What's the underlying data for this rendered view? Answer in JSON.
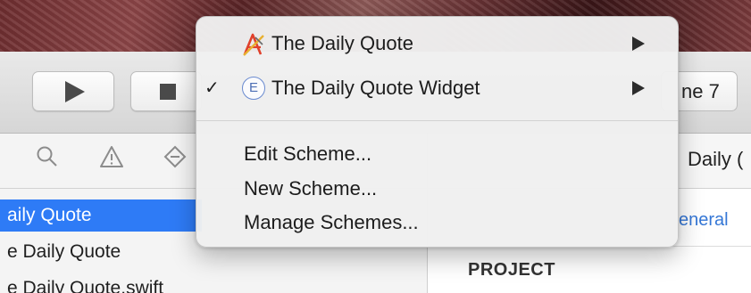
{
  "colors": {
    "accent": "#2e7bf6",
    "link": "#3577d6"
  },
  "toolbar": {
    "run_icon": "play-icon",
    "stop_icon": "stop-icon",
    "destination_partial": "ne 7"
  },
  "navigator": {
    "filter_icons": [
      "search-icon",
      "warning-icon",
      "breakpoint-icon"
    ],
    "rows": [
      {
        "label": "aily Quote",
        "selected": true
      },
      {
        "label": "e Daily Quote",
        "selected": false
      },
      {
        "label": "e Daily Quote.swift",
        "selected": false
      }
    ]
  },
  "editor": {
    "title_partial": "Daily (",
    "tab_partial": "eneral",
    "section_label": "PROJECT"
  },
  "scheme_menu": {
    "items": [
      {
        "label": "The Daily Quote",
        "icon": "xcode-app-icon",
        "checked": false,
        "submenu": true
      },
      {
        "label": "The Daily Quote Widget",
        "icon": "extension-icon",
        "icon_glyph": "E",
        "checked": true,
        "check_glyph": "✓",
        "submenu": true
      }
    ],
    "actions": [
      "Edit Scheme...",
      "New Scheme...",
      "Manage Schemes..."
    ]
  }
}
